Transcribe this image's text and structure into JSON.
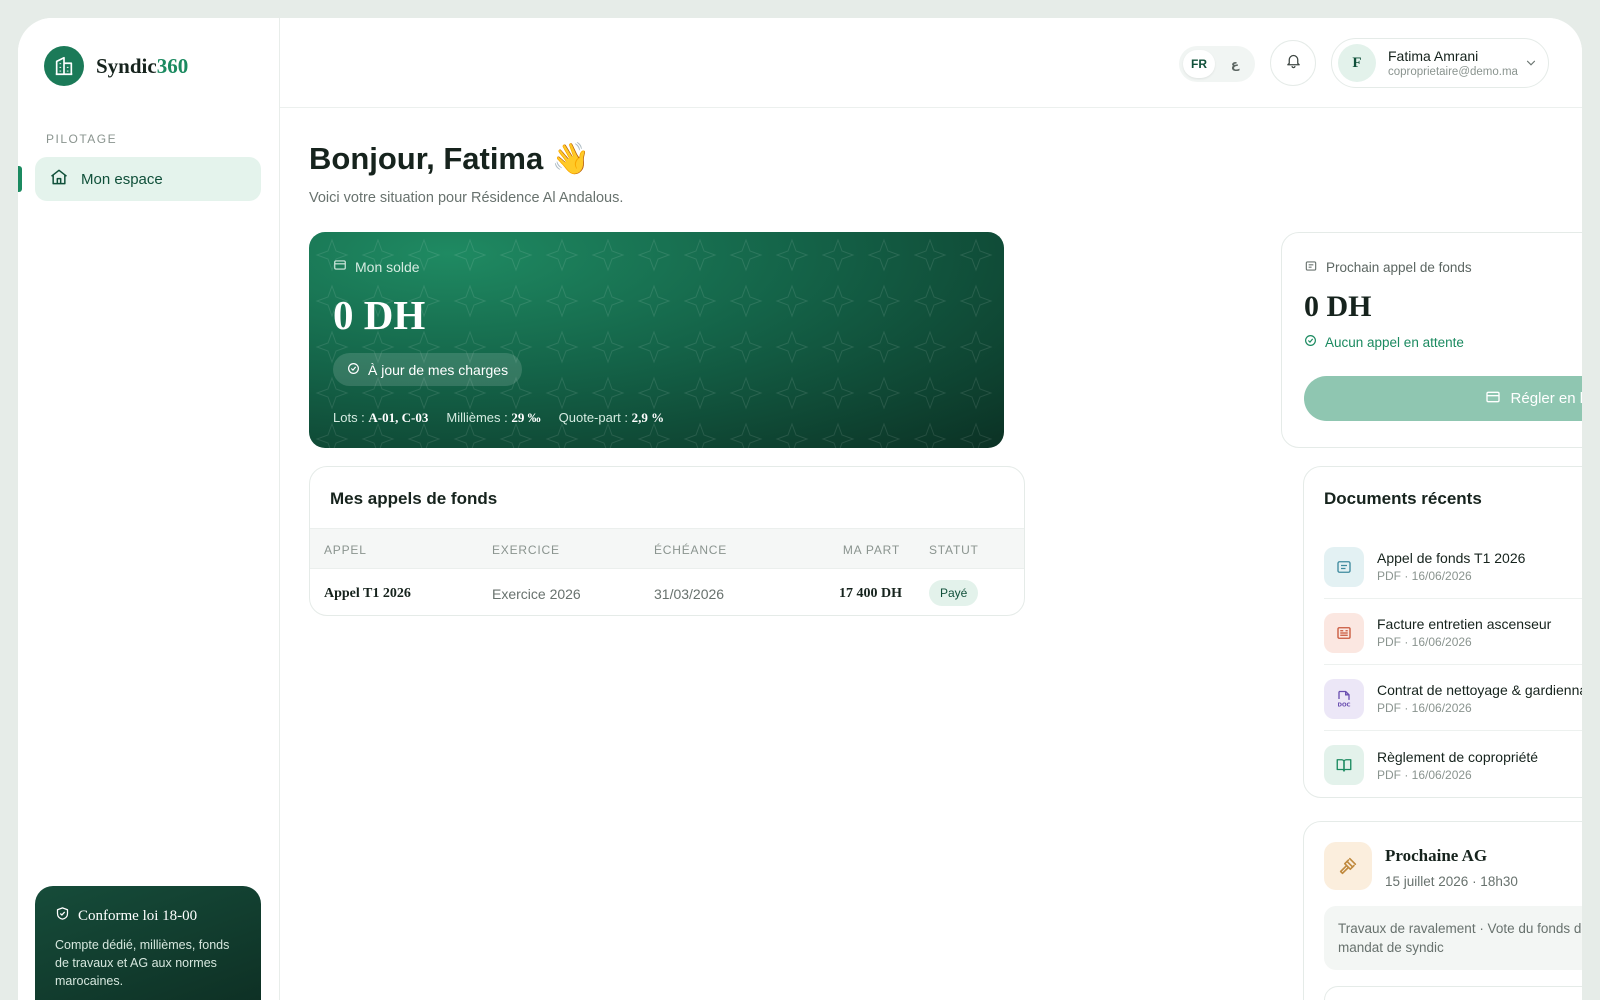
{
  "brand": {
    "name_part1": "Syndic",
    "name_part2": "360"
  },
  "sidebar": {
    "section": "PILOTAGE",
    "items": [
      {
        "label": "Mon espace"
      }
    ]
  },
  "compliance": {
    "title": "Conforme loi 18-00",
    "text": "Compte dédié, millièmes, fonds de travaux et AG aux normes marocaines."
  },
  "topbar": {
    "languages": [
      "FR",
      "ع"
    ],
    "active_language": "FR",
    "user": {
      "initial": "F",
      "name": "Fatima Amrani",
      "email": "coproprietaire@demo.ma"
    }
  },
  "greeting": {
    "title": "Bonjour, Fatima",
    "emoji": "👋",
    "subtitle": "Voici votre situation pour Résidence Al Andalous."
  },
  "balance": {
    "label": "Mon solde",
    "value": "0 DH",
    "badge": "À jour de mes charges",
    "lots_label": "Lots :",
    "lots_value": "A-01, C-03",
    "milliemes_label": "Millièmes :",
    "milliemes_value": "29 ‰",
    "quote_label": "Quote-part :",
    "quote_value": "2,9 %"
  },
  "next_call": {
    "label": "Prochain appel de fonds",
    "value": "0 DH",
    "status": "Aucun appel en attente",
    "pay_button": "Régler en ligne"
  },
  "calls": {
    "title": "Mes appels de fonds",
    "headers": [
      "APPEL",
      "EXERCICE",
      "ÉCHÉANCE",
      "MA PART",
      "STATUT"
    ],
    "rows": [
      {
        "appel": "Appel T1 2026",
        "exercice": "Exercice 2026",
        "echeance": "31/03/2026",
        "part": "17 400 DH",
        "statut": "Payé"
      }
    ]
  },
  "documents": {
    "title": "Documents récents",
    "items": [
      {
        "title": "Appel de fonds T1 2026",
        "meta": "PDF · 16/06/2026",
        "icon": "receipt-icon",
        "color": "#3e8a9e",
        "bg": "#e3f1f3"
      },
      {
        "title": "Facture entretien ascenseur",
        "meta": "PDF · 16/06/2026",
        "icon": "invoice-icon",
        "color": "#c9573b",
        "bg": "#fbe7e1"
      },
      {
        "title": "Contrat de nettoyage & gardiennage",
        "meta": "PDF · 16/06/2026",
        "icon": "doc-icon",
        "icon_text": "DOC",
        "color": "#6a4fb0",
        "bg": "#ece7f7"
      },
      {
        "title": "Règlement de copropriété",
        "meta": "PDF · 16/06/2026",
        "icon": "book-icon",
        "color": "#1b8a60",
        "bg": "#e3f2eb"
      }
    ]
  },
  "ag": {
    "title": "Prochaine AG",
    "date": "15 juillet 2026 · 18h30",
    "agenda": "Travaux de ravalement · Vote du fonds de travaux · Renouvellement du mandat de syndic"
  },
  "colors": {
    "accent": "#1b8a60",
    "dark_green": "#0b3124",
    "pay_button": "#8fc6b1",
    "ag_icon": "#c08a3e"
  }
}
